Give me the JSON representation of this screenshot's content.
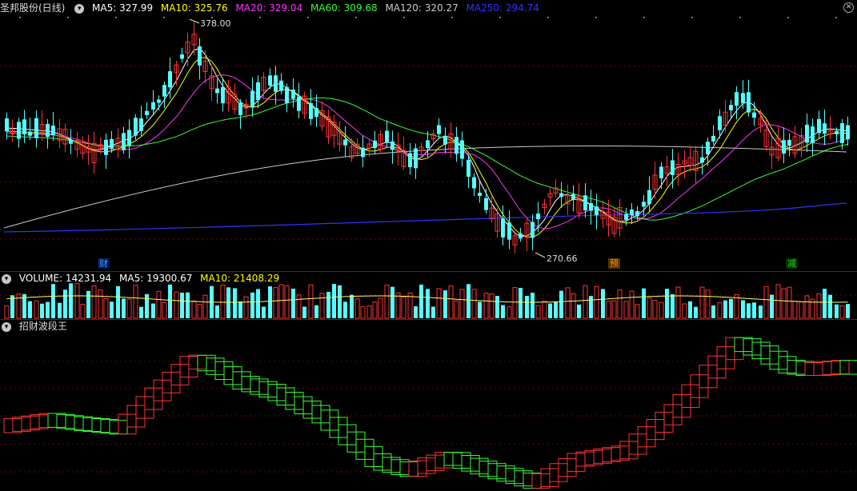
{
  "header": {
    "title": "圣邦股份(日线)",
    "ma": [
      {
        "label": "MA5: 327.99",
        "color": "#ffffff"
      },
      {
        "label": "MA10: 325.76",
        "color": "#ffff00"
      },
      {
        "label": "MA20: 329.04",
        "color": "#ff33ff"
      },
      {
        "label": "MA60: 309.68",
        "color": "#33ff33"
      },
      {
        "label": "MA120: 320.27",
        "color": "#cccccc"
      },
      {
        "label": "MA250: 294.74",
        "color": "#3333ff"
      }
    ]
  },
  "price_chart": {
    "high_label": "378.00",
    "low_label": "270.66",
    "events": [
      {
        "label": "财",
        "color": "#4aa0ff"
      },
      {
        "label": "预",
        "color": "#ff8c00"
      },
      {
        "label": "减",
        "color": "#33cc33"
      }
    ]
  },
  "volume_panel": {
    "labels": [
      {
        "label": "VOLUME: 14231.94",
        "color": "#ffffff"
      },
      {
        "label": "MA5: 19300.67",
        "color": "#ffffff"
      },
      {
        "label": "MA10: 21408.29",
        "color": "#ffff00"
      }
    ]
  },
  "indicator_panel": {
    "title": "招财波段王"
  },
  "colors": {
    "up": "#ff3333",
    "down": "#54ffff",
    "grid": "#7a0000"
  }
}
